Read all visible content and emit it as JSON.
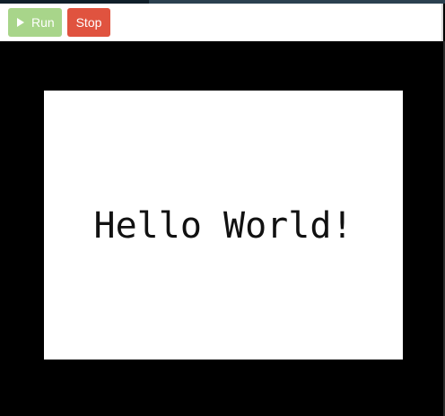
{
  "toolbar": {
    "run_label": "Run",
    "run_icon": "play-icon",
    "stop_label": "Stop"
  },
  "canvas": {
    "text": "Hello World!"
  },
  "colors": {
    "run_button": "#a8d58a",
    "stop_button": "#e0533f",
    "stage_background": "#000000",
    "canvas_background": "#ffffff",
    "top_strip": "#2b4150"
  }
}
